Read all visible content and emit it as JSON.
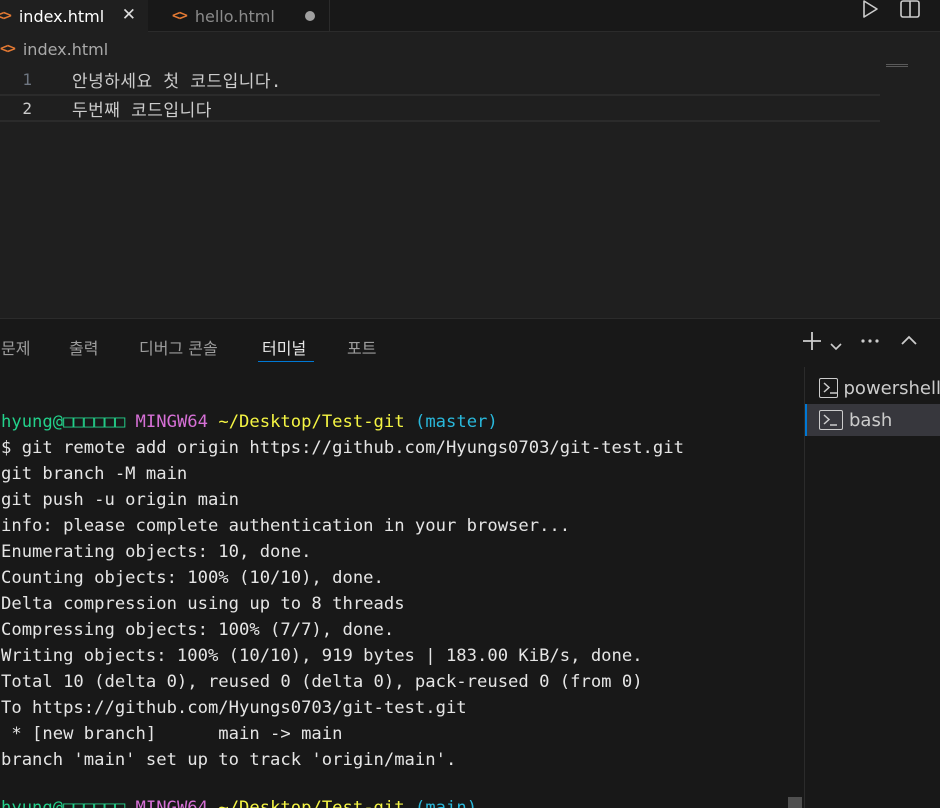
{
  "tabs": [
    {
      "label": "index.html",
      "icon": "html-file-icon",
      "state": "active"
    },
    {
      "label": "hello.html",
      "icon": "html-file-icon",
      "state": "unsaved"
    }
  ],
  "tab_close_glyph": "✕",
  "breadcrumb": {
    "file": "index.html"
  },
  "editor": {
    "lines": [
      {
        "num": "1",
        "text": "안녕하세요 첫 코드입니다."
      },
      {
        "num": "2",
        "text": "두번째 코드입니다"
      }
    ]
  },
  "panel": {
    "tabs": [
      "문제",
      "출력",
      "디버그 콘솔",
      "터미널",
      "포트"
    ],
    "active_tab": "터미널"
  },
  "terminal": {
    "prompt": {
      "user": "hyung@□□□□□□",
      "system": "MINGW64",
      "path": "~/Desktop/Test-git",
      "branch": "(master)"
    },
    "lines": [
      "$ git remote add origin https://github.com/Hyungs0703/git-test.git",
      "git branch -M main",
      "git push -u origin main",
      "info: please complete authentication in your browser...",
      "Enumerating objects: 10, done.",
      "Counting objects: 100% (10/10), done.",
      "Delta compression using up to 8 threads",
      "Compressing objects: 100% (7/7), done.",
      "Writing objects: 100% (10/10), 919 bytes | 183.00 KiB/s, done.",
      "Total 10 (delta 0), reused 0 (delta 0), pack-reused 0 (from 0)",
      "To https://github.com/Hyungs0703/git-test.git",
      " * [new branch]      main -> main",
      "branch 'main' set up to track 'origin/main'."
    ],
    "prompt2": {
      "user": "hyung@□□□□□□",
      "system": "MINGW64",
      "path": "~/Desktop/Test-git",
      "branch": "(main)"
    }
  },
  "terminal_list": [
    {
      "label": "powershell",
      "active": false
    },
    {
      "label": "bash",
      "active": true
    }
  ],
  "colors": {
    "accent": "#0078d4",
    "prompt_user": "#23d18b",
    "prompt_system": "#d670d6",
    "prompt_path": "#f5f543",
    "prompt_branch": "#29b8db"
  }
}
